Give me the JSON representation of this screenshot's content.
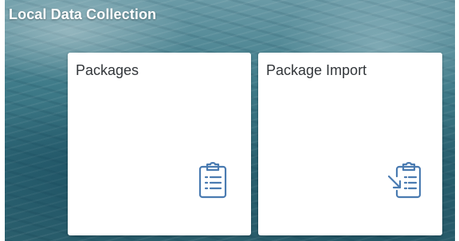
{
  "header": {
    "title": "Local Data Collection"
  },
  "tiles": [
    {
      "label": "Packages",
      "icon": "clipboard-list-icon"
    },
    {
      "label": "Package Import",
      "icon": "clipboard-import-icon"
    }
  ],
  "colors": {
    "tile_background": "#ffffff",
    "tile_text": "#32363a",
    "icon_blue": "#4a7bb1",
    "title_text": "#ffffff"
  }
}
